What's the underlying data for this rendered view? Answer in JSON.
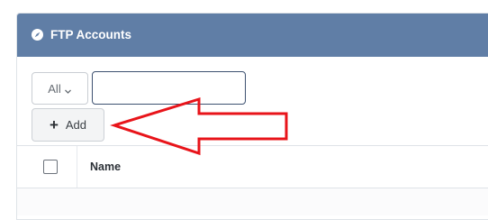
{
  "panel": {
    "title": "FTP Accounts",
    "header_icon": "compass-icon",
    "header_color": "#607ea6"
  },
  "toolbar": {
    "filter_value": "All",
    "filter_icon": "chevron-down-icon",
    "search_placeholder": "",
    "add_label": "Add",
    "add_icon": "plus-icon"
  },
  "table": {
    "columns": [
      "",
      "Name"
    ]
  },
  "annotation": {
    "arrow_color": "#e8141a",
    "points_to": "add-button"
  }
}
